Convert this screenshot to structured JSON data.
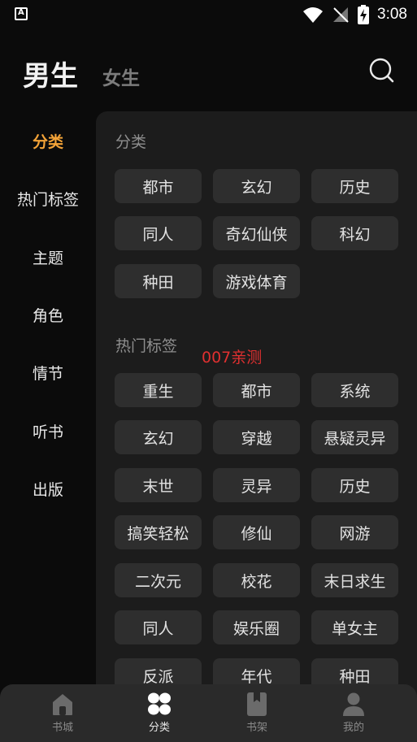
{
  "status_bar": {
    "time": "3:08",
    "left_icon_letter": "A"
  },
  "header": {
    "tab_male": "男生",
    "tab_female": "女生"
  },
  "side_nav": [
    "分类",
    "热门标签",
    "主题",
    "角色",
    "情节",
    "听书",
    "出版"
  ],
  "sections": {
    "category": {
      "title": "分类",
      "items": [
        "都市",
        "玄幻",
        "历史",
        "同人",
        "奇幻仙侠",
        "科幻",
        "种田",
        "游戏体育"
      ]
    },
    "hot_tags": {
      "title": "热门标签",
      "annotation": "007亲测",
      "items": [
        "重生",
        "都市",
        "系统",
        "玄幻",
        "穿越",
        "悬疑灵异",
        "末世",
        "灵异",
        "历史",
        "搞笑轻松",
        "修仙",
        "网游",
        "二次元",
        "校花",
        "末日求生",
        "同人",
        "娱乐圈",
        "单女主",
        "反派",
        "年代",
        "种田"
      ]
    }
  },
  "bottom_nav": [
    "书城",
    "分类",
    "书架",
    "我的"
  ],
  "colors": {
    "accent": "#f3a338",
    "annotation": "#e03030",
    "panel": "#1c1c1c",
    "chip": "#2e2e2e"
  }
}
